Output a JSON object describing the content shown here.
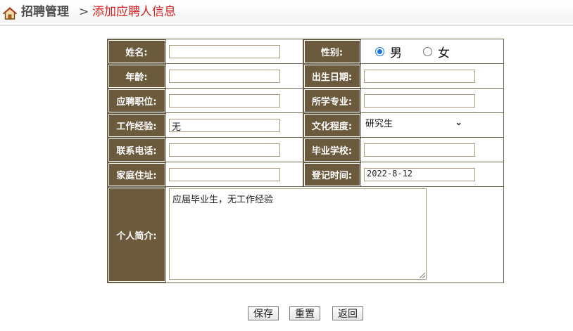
{
  "header": {
    "section": "招聘管理",
    "separator": ">",
    "current": "添加应聘人信息"
  },
  "form": {
    "name_label": "姓名:",
    "name_value": "",
    "gender_label": "性别:",
    "gender_options": [
      "男",
      "女"
    ],
    "gender_selected": "男",
    "age_label": "年龄:",
    "age_value": "",
    "birth_label": "出生日期:",
    "birth_value": "",
    "position_label": "应聘职位:",
    "position_value": "",
    "major_label": "所学专业:",
    "major_value": "",
    "experience_label": "工作经验:",
    "experience_value": "无",
    "education_label": "文化程度:",
    "education_value": "研究生",
    "phone_label": "联系电话:",
    "phone_value": "",
    "school_label": "毕业学校:",
    "school_value": "",
    "address_label": "家庭住址:",
    "address_value": "",
    "regtime_label": "登记时间:",
    "regtime_value": "2022-8-12",
    "intro_label": "个人简介:",
    "intro_value": "应届毕业生，无工作经验"
  },
  "buttons": {
    "save": "保存",
    "reset": "重置",
    "back": "返回"
  },
  "colors": {
    "label_bg": "#6b5a3c",
    "current_crumb": "#d42020",
    "radio_accent": "#1a73e8"
  }
}
